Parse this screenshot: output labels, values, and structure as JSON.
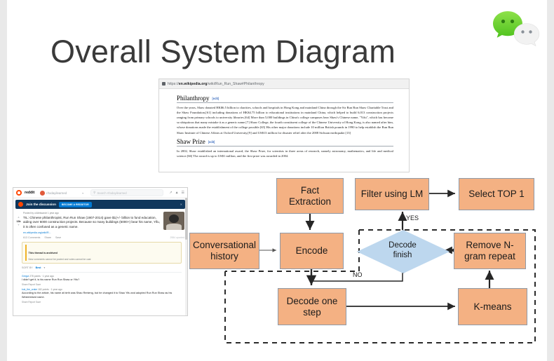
{
  "slide": {
    "title": "Overall System Diagram",
    "logo": {
      "name": "wechat-logo",
      "alt": "WeChat"
    }
  },
  "wiki_screenshot": {
    "url_prefix": "https://",
    "url_domain": "en.wikipedia.org",
    "url_path": "/wiki/Run_Run_Shaw#Philanthropy",
    "sections": [
      {
        "heading": "Philanthropy",
        "edit_label": "[edit]",
        "paragraphs": [
          "Over the years, Shaw donated HK$6.5 billion to charities, schools and hospitals in Hong Kong and mainland China through the Sir Run Run Shaw Charitable Trust and the Shaw Foundation,[61] including donations of HK$4.75 billion to educational institutions in mainland China, which helped to build 6,013 construction projects ranging from primary schools to university libraries.[64] More than 5,000 buildings in China's college campuses bear Shaw's Chinese name, \"Yifu\", which has become so ubiquitous that many mistake it as a generic name.[7] Shaw College, the fourth constituent college of the Chinese University of Hong Kong, is also named after him, whose donations made the establishment of the college possible.[65] His other major donations include 10 million British pounds in 1990 to help establish the Run Run Shaw Institute of Chinese Affairs at Oxford University,[9] and US$13 million for disaster relief after the 2008 Sichuan earthquake.[13]"
        ]
      },
      {
        "heading": "Shaw Prize",
        "edit_label": "[edit]",
        "paragraphs": [
          "In 2002, Shaw established an international award, the Shaw Prize, for scientists in three areas of research, namely astronomy, mathematics, and life and medical science.[66] The award is up to US$1 million, and the first prize was awarded in 2004."
        ]
      }
    ]
  },
  "reddit_screenshot": {
    "topbar": {
      "brand": "reddit",
      "subreddit": "r/todayilearned",
      "caret_icon": "chevron-down-icon",
      "search_icon": "search-icon",
      "search_placeholder": "Search r/todayilearned",
      "icons": [
        "trending-icon",
        "notifications-icon",
        "menu-icon"
      ]
    },
    "banner": {
      "text": "Join the discussion",
      "button": "BECOME A REDDITOR",
      "close_icon": "close-icon"
    },
    "post": {
      "upvote_icon": "upvote-icon",
      "downvote_icon": "downvote-icon",
      "score": "13k",
      "meta": "Posted by u/Aleksandr 1 year ago",
      "title": "TIL: Chinese philanthropist, Run Run Shaw (1907-2014) gave $1(+/- billion to fund education, aiding over 6000 construction projects. Because so many buildings (5000+) bear his name, Yifu, it is often confused as a generic name.",
      "link": "en.wikipedia.org/wiki/R...",
      "actions": [
        "613 Comments",
        "Share",
        "Save"
      ],
      "action_right": "2984 upvoted",
      "thumbnail": "post-thumbnail"
    },
    "notice": {
      "title": "This thread is archived",
      "body": "New comments cannot be posted and votes cannot be cast"
    },
    "sort": {
      "label": "SORT BY",
      "value": "Best",
      "caret_icon": "chevron-down-icon"
    },
    "comments": [
      {
        "meta_user": "Gregul",
        "meta_rest": "278 points · 1 year ago",
        "text": "I didn't get it, is his name Run Run Shaw or Yifu?",
        "actions": "Share  Report  Save"
      },
      {
        "meta_user": "kuk_the_crake",
        "meta_rest": "182 points · 1 year ago",
        "text": "According to the article, his name at birth was Shao Renleng, but he changed it to Shao Yifu and adopted Run Run Shaw as his Westernised name.",
        "actions": "Share  Report  Save"
      }
    ],
    "scrollbar": "vertical-scrollbar"
  },
  "flowchart": {
    "colors": {
      "process": "#F4B183",
      "decision": "#BDD7EE",
      "border": "#8f9aa8",
      "edge": "#262626"
    },
    "nodes": [
      {
        "id": "fact-extraction",
        "label": "Fact\nExtraction",
        "shape": "rect"
      },
      {
        "id": "filter-using-lm",
        "label": "Filter using LM",
        "shape": "rect"
      },
      {
        "id": "select-top-1",
        "label": "Select TOP 1",
        "shape": "rect"
      },
      {
        "id": "conversational-history",
        "label": "Conversational\nhistory",
        "shape": "rect"
      },
      {
        "id": "encode",
        "label": "Encode",
        "shape": "rect"
      },
      {
        "id": "decode-finish",
        "label": "Decode\nfinish",
        "shape": "diamond"
      },
      {
        "id": "remove-n-gram-repeat",
        "label": "Remove N-\ngram repeat",
        "shape": "rect"
      },
      {
        "id": "decode-one-step",
        "label": "Decode one\nstep",
        "shape": "rect"
      },
      {
        "id": "k-means",
        "label": "K-means",
        "shape": "rect"
      }
    ],
    "edge_labels": {
      "yes": "YES",
      "no": "NO"
    },
    "edges": [
      {
        "from": "fact-extraction",
        "to": "encode",
        "style": "solid"
      },
      {
        "from": "filter-using-lm",
        "to": "select-top-1",
        "style": "solid"
      },
      {
        "from": "conversational-history",
        "to": "encode",
        "style": "solid"
      },
      {
        "from": "decode-finish",
        "to": "filter-using-lm",
        "style": "solid",
        "label": "YES"
      },
      {
        "from": "decode-finish",
        "to": "decode-one-step",
        "style": "solid",
        "label": "NO"
      },
      {
        "from": "encode",
        "to": "decode-one-step",
        "style": "solid"
      },
      {
        "from": "decode-one-step",
        "to": "k-means",
        "style": "solid"
      },
      {
        "from": "k-means",
        "to": "remove-n-gram-repeat",
        "style": "solid"
      },
      {
        "from": "remove-n-gram-repeat",
        "to": "decode-finish",
        "style": "solid"
      },
      {
        "from": "loop-back",
        "to": "encode",
        "style": "dashed"
      }
    ]
  }
}
